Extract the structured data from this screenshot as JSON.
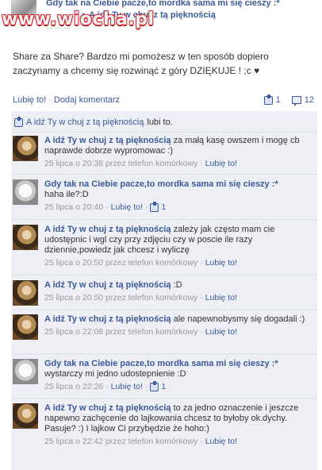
{
  "header": {
    "author": "Gdy tak na Ciebie pacze,to mordka sama mi się cieszy :*",
    "page_name": "A idź Ty w chuj z tą pięknością",
    "timestamp": "... ... ...",
    "watermark": "www.wiocha.pl"
  },
  "post": {
    "text": "Share za Share? Bardzo mi pomożesz w ten sposób dopiero zaczynamy a chcemy się rozwinąć z góry DZIĘKUJE ! ;c ♥"
  },
  "actions": {
    "like": "Lubię to!",
    "comment": "Dodaj komentarz",
    "like_count": "1",
    "comment_count": "12"
  },
  "likes": {
    "name": "A idź Ty w chuj z tą pięknością",
    "suffix": "lubi to."
  },
  "comments": [
    {
      "author": "A idź Ty w chuj z tą pięknością",
      "text": "za małą kasę owszem i mogę cb naprawde dobrze wypromowac :)",
      "time": "25 lipca o 20:38 przez telefon komórkowy",
      "like": "Lubię to!",
      "likes": ""
    },
    {
      "author": "Gdy tak na Ciebie pacze,to mordka sama mi się cieszy :*",
      "text": "haha ile?:D",
      "time": "25 lipca o 20:40",
      "like": "Lubię to!",
      "likes": "1"
    },
    {
      "author": "A idź Ty w chuj z tą pięknością",
      "text": "zależy jak często mam cie udostępnic i wgl czy przy zdjęciu czy w poscie ile razy dziennie,powiedz jak chcesz i wyliczę",
      "time": "25 lipca o 20:50 przez telefon komórkowy",
      "like": "Lubię to!",
      "likes": ""
    },
    {
      "author": "A idź Ty w chuj z tą pięknością",
      "text": ":D",
      "time": "25 lipca o 20:50 przez telefon komórkowy",
      "like": "Lubię to!",
      "likes": ""
    },
    {
      "author": "A idź Ty w chuj z tą pięknością",
      "text": "ale napewnobysmy się dogadali :)",
      "time": "25 lipca o 22:08 przez telefon komórkowy",
      "like": "Lubię to!",
      "likes": ""
    },
    {
      "author": "Gdy tak na Ciebie pacze,to mordka sama mi się cieszy :*",
      "text": "wystarczy mi jedno udostepnienie :D",
      "time": "25 lipca o 22:26",
      "like": "Lubię to!",
      "likes": "1"
    },
    {
      "author": "A idź Ty w chuj z tą pięknością",
      "text": "to za jedno oznaczenie i jeszcze napewno zachęcenie do lajkowania chcesz to byłoby ok.dychy. Pasuje? :) I lajkow Ci przybędzie że hoho:)",
      "time": "25 lipca o 22:42 przez telefon komórkowy",
      "like": "Lubię to!",
      "likes": ""
    }
  ],
  "colors": {
    "link": "#3b5998",
    "panel": "#edeff4",
    "watermark": "#d8252b"
  }
}
